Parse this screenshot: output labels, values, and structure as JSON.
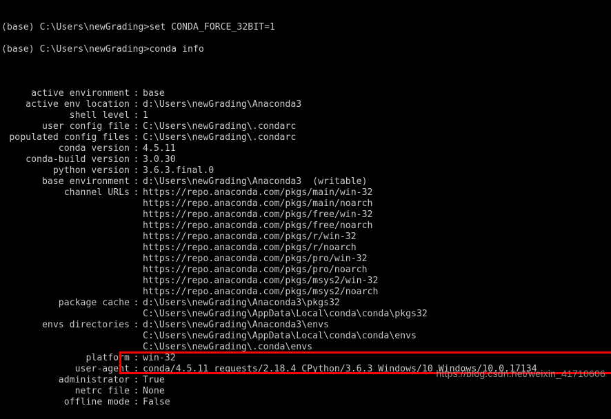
{
  "terminal": {
    "background_color": "#000000",
    "text_color": "#c8c8c8",
    "prompt_lines": [
      "(base) C:\\Users\\newGrading>set CONDA_FORCE_32BIT=1",
      "(base) C:\\Users\\newGrading>conda info"
    ],
    "info_rows": [
      {
        "label": "active environment",
        "values": [
          "base"
        ]
      },
      {
        "label": "active env location",
        "values": [
          "d:\\Users\\newGrading\\Anaconda3"
        ]
      },
      {
        "label": "shell level",
        "values": [
          "1"
        ]
      },
      {
        "label": "user config file",
        "values": [
          "C:\\Users\\newGrading\\.condarc"
        ]
      },
      {
        "label": "populated config files",
        "values": [
          "C:\\Users\\newGrading\\.condarc"
        ]
      },
      {
        "label": "conda version",
        "values": [
          "4.5.11"
        ]
      },
      {
        "label": "conda-build version",
        "values": [
          "3.0.30"
        ]
      },
      {
        "label": "python version",
        "values": [
          "3.6.3.final.0"
        ]
      },
      {
        "label": "base environment",
        "values": [
          "d:\\Users\\newGrading\\Anaconda3  (writable)"
        ]
      },
      {
        "label": "channel URLs",
        "values": [
          "https://repo.anaconda.com/pkgs/main/win-32",
          "https://repo.anaconda.com/pkgs/main/noarch",
          "https://repo.anaconda.com/pkgs/free/win-32",
          "https://repo.anaconda.com/pkgs/free/noarch",
          "https://repo.anaconda.com/pkgs/r/win-32",
          "https://repo.anaconda.com/pkgs/r/noarch",
          "https://repo.anaconda.com/pkgs/pro/win-32",
          "https://repo.anaconda.com/pkgs/pro/noarch",
          "https://repo.anaconda.com/pkgs/msys2/win-32",
          "https://repo.anaconda.com/pkgs/msys2/noarch"
        ]
      },
      {
        "label": "package cache",
        "values": [
          "d:\\Users\\newGrading\\Anaconda3\\pkgs32",
          "C:\\Users\\newGrading\\AppData\\Local\\conda\\conda\\pkgs32"
        ]
      },
      {
        "label": "envs directories",
        "values": [
          "d:\\Users\\newGrading\\Anaconda3\\envs",
          "C:\\Users\\newGrading\\AppData\\Local\\conda\\conda\\envs",
          "C:\\Users\\newGrading\\.conda\\envs"
        ]
      },
      {
        "label": "platform",
        "values": [
          "win-32"
        ]
      },
      {
        "label": "user-agent",
        "values": [
          "conda/4.5.11 requests/2.18.4 CPython/3.6.3 Windows/10 Windows/10.0.17134"
        ]
      },
      {
        "label": "administrator",
        "values": [
          "True"
        ]
      },
      {
        "label": "netrc file",
        "values": [
          "None"
        ]
      },
      {
        "label": "offline mode",
        "values": [
          "False"
        ]
      }
    ]
  },
  "highlight": {
    "target_label": "platform",
    "target_value": "win-32",
    "color": "#fe0000"
  },
  "watermark": {
    "text": "https://blog.csdn.net/weixin_41710606",
    "color": "#8c8c8c"
  }
}
